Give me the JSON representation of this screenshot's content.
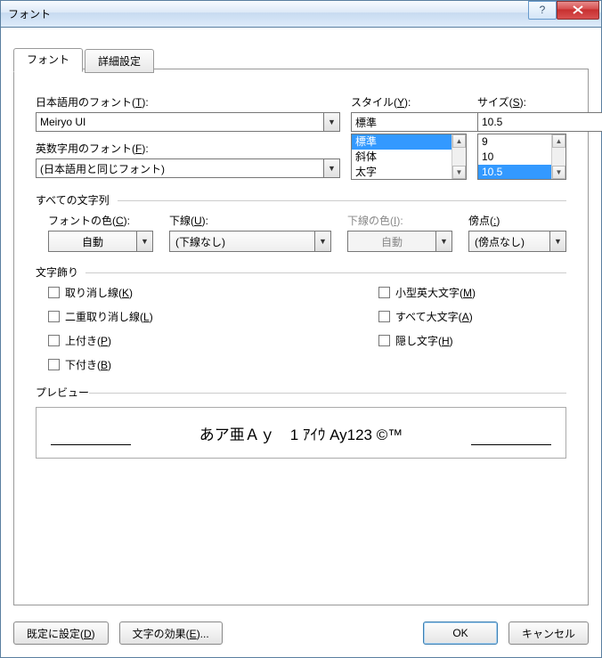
{
  "window": {
    "title": "フォント"
  },
  "tabs": {
    "font": "フォント",
    "advanced": "詳細設定"
  },
  "jpfont": {
    "label": "日本語用のフォント(T):",
    "value": "Meiryo UI"
  },
  "latinfont": {
    "label": "英数字用のフォント(F):",
    "value": "(日本語用と同じフォント)"
  },
  "style": {
    "label": "スタイル(Y):",
    "value": "標準",
    "options": [
      "標準",
      "斜体",
      "太字"
    ],
    "selectedIndex": 0
  },
  "size": {
    "label": "サイズ(S):",
    "value": "10.5",
    "options": [
      "9",
      "10",
      "10.5"
    ],
    "selectedIndex": 2
  },
  "allchars": {
    "title": "すべての文字列",
    "fontcolor": {
      "label": "フォントの色(C):",
      "value": "自動"
    },
    "underline": {
      "label": "下線(U):",
      "value": "(下線なし)"
    },
    "underlinecolor": {
      "label": "下線の色(I):",
      "value": "自動"
    },
    "emphasis": {
      "label": "傍点(:)",
      "value": "(傍点なし)"
    }
  },
  "decor": {
    "title": "文字飾り",
    "strike": "取り消し線(K)",
    "dstrike": "二重取り消し線(L)",
    "super": "上付き(P)",
    "sub": "下付き(B)",
    "smallcaps": "小型英大文字(M)",
    "allcaps": "すべて大文字(A)",
    "hidden": "隠し文字(H)"
  },
  "preview": {
    "title": "プレビュー",
    "sample": "あア亜Ａｙ　1 ｱｲｳ Ay123 ©™"
  },
  "footer": {
    "setdefault": "既定に設定(D)",
    "texteffects": "文字の効果(E)...",
    "ok": "OK",
    "cancel": "キャンセル"
  }
}
